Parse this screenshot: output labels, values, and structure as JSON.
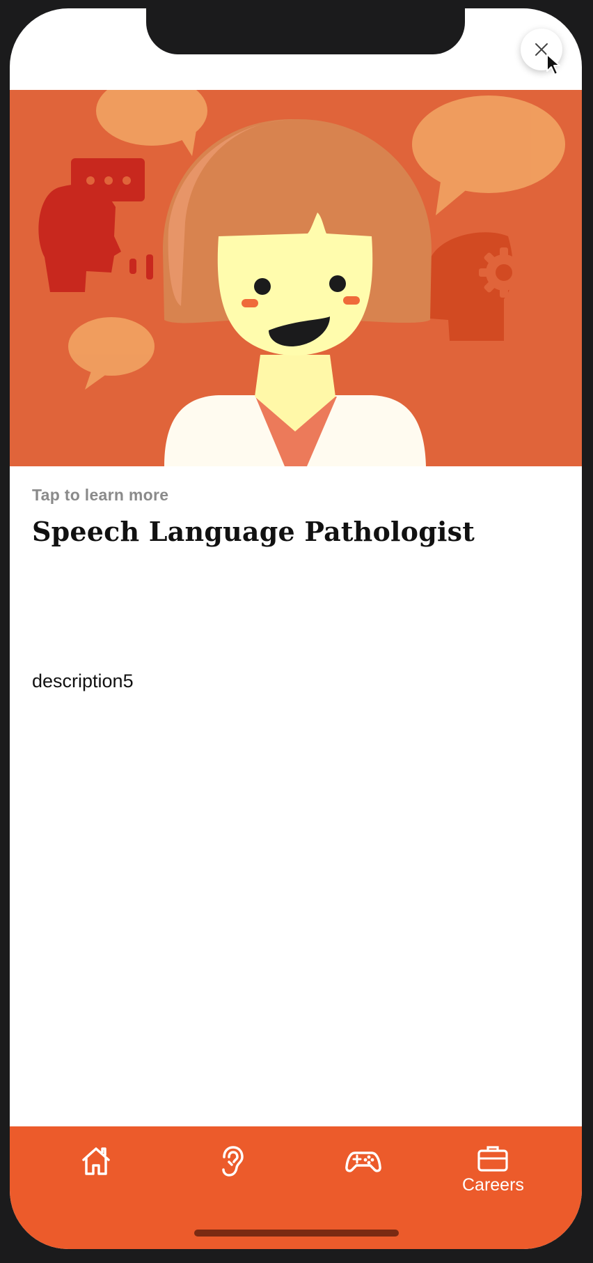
{
  "hero": {
    "image_alt": "speech-language-pathologist-illustration"
  },
  "content": {
    "eyebrow": "Tap to learn more",
    "title": "Speech Language Pathologist",
    "description": "description5"
  },
  "close_button": {
    "icon": "close-icon"
  },
  "tabbar": {
    "tabs": [
      {
        "icon": "home-icon",
        "label": ""
      },
      {
        "icon": "ear-icon",
        "label": ""
      },
      {
        "icon": "gamepad-icon",
        "label": ""
      },
      {
        "icon": "briefcase-icon",
        "label": "Careers",
        "active": true
      }
    ]
  },
  "colors": {
    "hero_bg": "#e0643a",
    "tabbar_bg": "#ec5b2b",
    "text": "#111111",
    "muted": "#8a8a8a"
  }
}
